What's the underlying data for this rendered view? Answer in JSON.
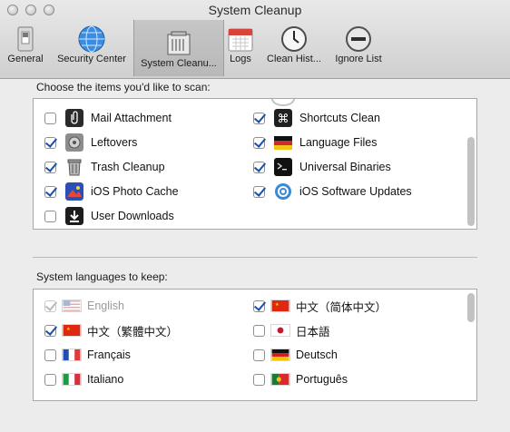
{
  "window": {
    "title": "System Cleanup"
  },
  "toolbar": {
    "items": [
      {
        "label": "General",
        "icon": "switch-icon"
      },
      {
        "label": "Security Center",
        "icon": "globe-icon"
      },
      {
        "label": "System Cleanu...",
        "icon": "trash-can-icon",
        "active": true
      },
      {
        "label": "Logs",
        "icon": "calendar-icon"
      },
      {
        "label": "Clean Hist...",
        "icon": "clock-icon"
      },
      {
        "label": "Ignore List",
        "icon": "minus-circle-icon"
      }
    ]
  },
  "scan_section": {
    "label": "Choose the items you'd like to scan:",
    "left_items": [
      {
        "label": "Mail Attachment",
        "checked": false,
        "icon": "paperclip-icon"
      },
      {
        "label": "Leftovers",
        "checked": true,
        "icon": "leftovers-icon"
      },
      {
        "label": "Trash Cleanup",
        "checked": true,
        "icon": "trash-icon"
      },
      {
        "label": "iOS Photo Cache",
        "checked": true,
        "icon": "photo-icon"
      },
      {
        "label": "User Downloads",
        "checked": false,
        "icon": "download-icon"
      }
    ],
    "right_items": [
      {
        "label": "Shortcuts Clean",
        "checked": true,
        "icon": "command-key-icon"
      },
      {
        "label": "Language Files",
        "checked": true,
        "icon": "flag-icon"
      },
      {
        "label": "Universal Binaries",
        "checked": true,
        "icon": "terminal-icon"
      },
      {
        "label": "iOS Software Updates",
        "checked": true,
        "icon": "ios-update-icon"
      }
    ]
  },
  "language_section": {
    "label": "System languages to keep:",
    "left_items": [
      {
        "label": "English",
        "checked": true,
        "disabled": true,
        "flag": "us-flag-icon"
      },
      {
        "label": "中文（繁體中文）",
        "checked": true,
        "flag": "cn-flag-icon"
      },
      {
        "label": "Français",
        "checked": false,
        "flag": "fr-flag-icon"
      },
      {
        "label": "Italiano",
        "checked": false,
        "flag": "it-flag-icon"
      }
    ],
    "right_items": [
      {
        "label": "中文（简体中文）",
        "checked": true,
        "flag": "cn-flag-icon"
      },
      {
        "label": "日本語",
        "checked": false,
        "flag": "jp-flag-icon"
      },
      {
        "label": "Deutsch",
        "checked": false,
        "flag": "de-flag-icon"
      },
      {
        "label": "Português",
        "checked": false,
        "flag": "pt-flag-icon"
      }
    ]
  }
}
